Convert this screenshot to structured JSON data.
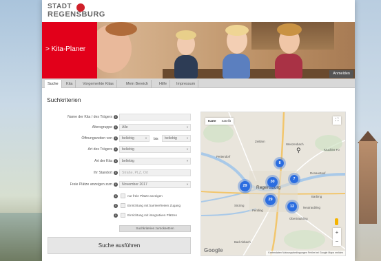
{
  "header": {
    "logo_line1": "STADT",
    "logo_line2": "REGENSBURG",
    "banner_title": "> Kita-Planer",
    "login_button": "Anmelden"
  },
  "tabs": [
    {
      "label": "Suche",
      "active": true
    },
    {
      "label": "Kita",
      "active": false
    },
    {
      "label": "Vorgemerkte Kitas",
      "active": false
    },
    {
      "label": "Mein Bereich",
      "active": false
    },
    {
      "label": "Hilfe",
      "active": false
    },
    {
      "label": "Impressum",
      "active": false
    }
  ],
  "form": {
    "heading": "Suchkriterien",
    "name_label": "Name der Kita / des Trägers",
    "name_value": "",
    "age_label": "Altersgruppe",
    "age_value": "Alle",
    "hours_label": "Öffnungszeiten von",
    "hours_from": "beliebig",
    "hours_to_label": "bis",
    "hours_to": "beliebig",
    "carrier_label": "Art des Trägers",
    "carrier_value": "beliebig",
    "kita_type_label": "Art der Kita",
    "kita_type_value": "beliebig",
    "location_label": "Ihr Standort",
    "location_placeholder": "Straße, PLZ, Ort",
    "free_label": "Freie Plätze anzeigen zum",
    "free_value": "November 2017",
    "check1": "nur freie Plätze anzeigen",
    "check2": "Einrichtung mit barrierefreiem Zugang",
    "check3": "Einrichtung mit integrativen Plätzen",
    "reset_button": "Suchkriterien zurücksetzen",
    "search_button": "Suche ausführen"
  },
  "map": {
    "type_map": "Karte",
    "type_satellite": "Satellit",
    "fullscreen_icon": "fullscreen-icon",
    "zoom_in": "+",
    "zoom_out": "−",
    "google_logo": "Google",
    "attribution": "Kartendaten    Nutzungsbedingungen    Fehler bei Google Maps melden",
    "places": {
      "regensburg": "Regensburg",
      "zeitlarn": "Zeitlarn",
      "wenzenbach": "Wenzenbach",
      "pettendorf": "Pettendorf",
      "donaustauf": "Donaustauf",
      "sinzing": "Sinzing",
      "pentling": "Pentling",
      "barbing": "Barbing",
      "neutraubling": "Neutraubling",
      "obertraubling": "Obertraubling",
      "bad_abbach": "Bad Abbach",
      "kruchler": "Kruchler Fo"
    },
    "clusters": {
      "c1": "8",
      "c2": "29",
      "c3": "30",
      "c4": "7",
      "c5": "29",
      "c6": "12"
    }
  }
}
